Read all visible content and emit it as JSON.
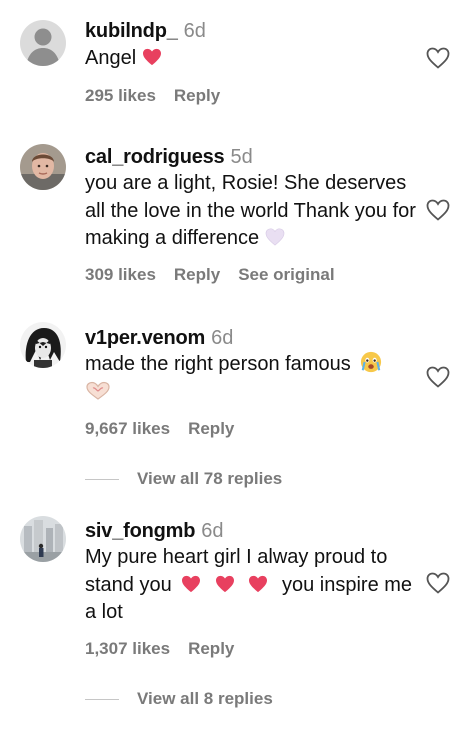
{
  "comments": [
    {
      "username": "kubilndp_",
      "time": "6d",
      "text": "Angel",
      "likes": "295 likes",
      "reply": "Reply",
      "avatar": "default-avatar-icon"
    },
    {
      "username": "cal_rodriguess",
      "time": "5d",
      "text": "you are a light, Rosie! She deserves all the love in the world Thank you for making a difference",
      "likes": "309 likes",
      "reply": "Reply",
      "see_original": "See original",
      "avatar": "user-photo"
    },
    {
      "username": "v1per.venom",
      "time": "6d",
      "text": "made the right person famous",
      "likes": "9,667 likes",
      "reply": "Reply",
      "view_replies": "View all 78 replies",
      "avatar": "anime-avatar"
    },
    {
      "username": "siv_fongmb",
      "time": "6d",
      "text_before": "My pure heart girl I alway proud to stand you",
      "text_after": "you inspire me a lot",
      "likes": "1,307 likes",
      "reply": "Reply",
      "view_replies": "View all 8 replies",
      "avatar": "city-photo"
    }
  ],
  "colors": {
    "text": "#111111",
    "muted": "#7a7a7a",
    "emoji_heart": "#e8405f",
    "white_heart": "#e9dff2"
  }
}
